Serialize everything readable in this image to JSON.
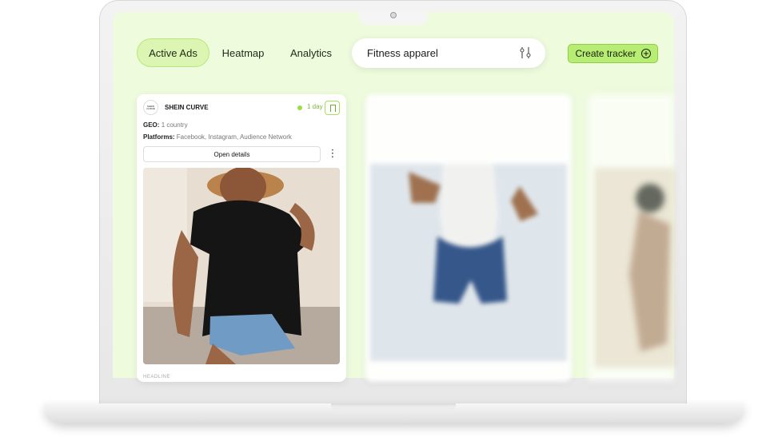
{
  "navigation": {
    "active_ads": "Active Ads",
    "heatmap": "Heatmap",
    "analytics": "Analytics"
  },
  "search": {
    "value": "Fitness apparel"
  },
  "actions": {
    "create_tracker": "Create tracker"
  },
  "cards": [
    {
      "brand": "SHEIN CURVE",
      "logo_text": "SHEIN CURVE",
      "duration": "1 day",
      "geo_label": "GEO:",
      "geo_value": "1 country",
      "platforms_label": "Platforms:",
      "platforms_value": "Facebook, Instagram, Audience Network",
      "details_label": "Open details",
      "more_label": "⋮",
      "headline_label": "HEADLINE"
    }
  ],
  "colors": {
    "screen_background": "#eefbdd",
    "accent": "#b7ed72",
    "accent_border": "#8fcd48"
  },
  "icons": {
    "filter": "filter-icon",
    "create": "plus-circle-icon",
    "save": "bookmark-icon",
    "more": "vertical-ellipsis-icon"
  }
}
